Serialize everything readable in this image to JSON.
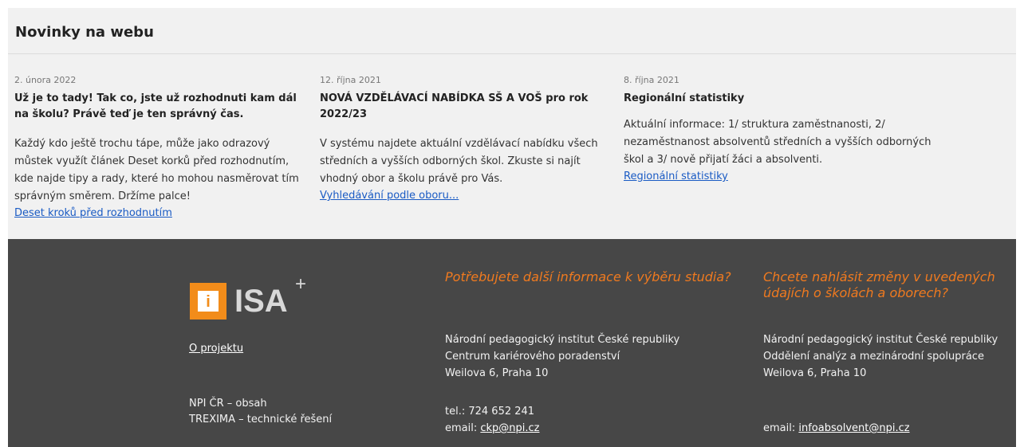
{
  "news": {
    "title": "Novinky na webu",
    "articles": [
      {
        "date": "2. února 2022",
        "headline": "Už je to tady! Tak co, jste už rozhodnuti kam dál na školu? Právě teď je ten správný čas.",
        "excerpt": "Každý kdo ještě trochu tápe, může jako odrazový můstek využít článek Deset korků před rozhodnutím, kde najde tipy a rady, které ho mohou nasměrovat tím správným směrem. Držíme palce!",
        "link": "Deset kroků před rozhodnutím"
      },
      {
        "date": "12. října 2021",
        "headline": "NOVÁ VZDĚLÁVACÍ NABÍDKA SŠ A VOŠ pro rok 2022/23",
        "excerpt": "V systému najdete aktuální vzdělávací nabídku všech středních a vyšších odborných škol. Zkuste si najít vhodný obor a školu právě pro Vás.",
        "link": "Vyhledávání podle oboru..."
      },
      {
        "date": "8. října 2021",
        "headline": "Regionální statistiky",
        "excerpt": "Aktuální informace: 1/ struktura zaměstnanosti, 2/ nezaměstnanost absolventů středních a vyšších odborných škol a 3/ nově přijatí žáci a absolventi.",
        "link": "Regionální statistiky"
      }
    ]
  },
  "footer": {
    "logo": {
      "box_letter": "i",
      "text": "ISA",
      "sup": "+"
    },
    "about_link": "O projektu",
    "credits": [
      "NPI ČR – obsah",
      "TREXIMA – technické řešení"
    ],
    "columns": [
      {
        "heading": "Potřebujete další informace k výběru studia?",
        "address": [
          "Národní pedagogický institut České republiky",
          "Centrum kariérového poradenství",
          "Weilova 6, Praha 10"
        ],
        "phone": "tel.: 724 652 241",
        "email_label": "email: ",
        "email": "ckp@npi.cz"
      },
      {
        "heading": "Chcete nahlásit změny v uvedených údajích o školách a oborech?",
        "address": [
          "Národní pedagogický institut České republiky",
          "Oddělení analýz a mezinárodní spolupráce",
          "Weilova 6, Praha 10"
        ],
        "email_label": "email: ",
        "email": "infoabsolvent@npi.cz"
      }
    ]
  },
  "colors": {
    "footer_bg": "#474747",
    "accent_orange": "#f07a1f",
    "link_blue": "#1a5bc4",
    "news_bg": "#f1f1f1"
  }
}
